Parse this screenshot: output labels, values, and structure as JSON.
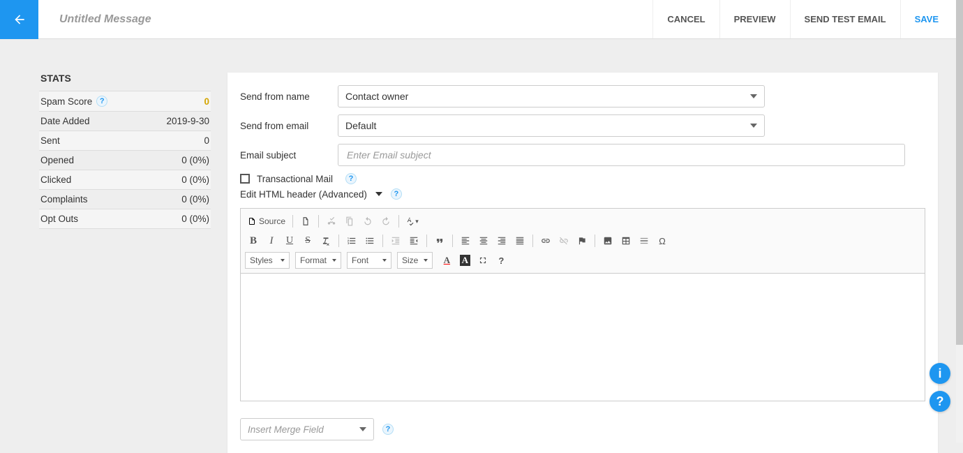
{
  "header": {
    "title": "Untitled Message",
    "actions": {
      "cancel": "CANCEL",
      "preview": "PREVIEW",
      "send_test": "SEND TEST EMAIL",
      "save": "SAVE"
    }
  },
  "stats": {
    "title": "STATS",
    "items": [
      {
        "label": "Spam Score",
        "value": "0",
        "help": true,
        "warn": true
      },
      {
        "label": "Date Added",
        "value": "2019-9-30"
      },
      {
        "label": "Sent",
        "value": "0"
      },
      {
        "label": "Opened",
        "value": "0 (0%)"
      },
      {
        "label": "Clicked",
        "value": "0 (0%)"
      },
      {
        "label": "Complaints",
        "value": "0 (0%)"
      },
      {
        "label": "Opt Outs",
        "value": "0 (0%)"
      }
    ]
  },
  "form": {
    "from_name_label": "Send from name",
    "from_name_value": "Contact owner",
    "from_email_label": "Send from email",
    "from_email_value": "Default",
    "subject_label": "Email subject",
    "subject_placeholder": "Enter Email subject",
    "transactional_label": "Transactional Mail",
    "advanced_label": "Edit HTML header (Advanced)",
    "merge_placeholder": "Insert Merge Field"
  },
  "toolbar": {
    "source": "Source",
    "styles": "Styles",
    "format": "Format",
    "font": "Font",
    "size": "Size"
  }
}
